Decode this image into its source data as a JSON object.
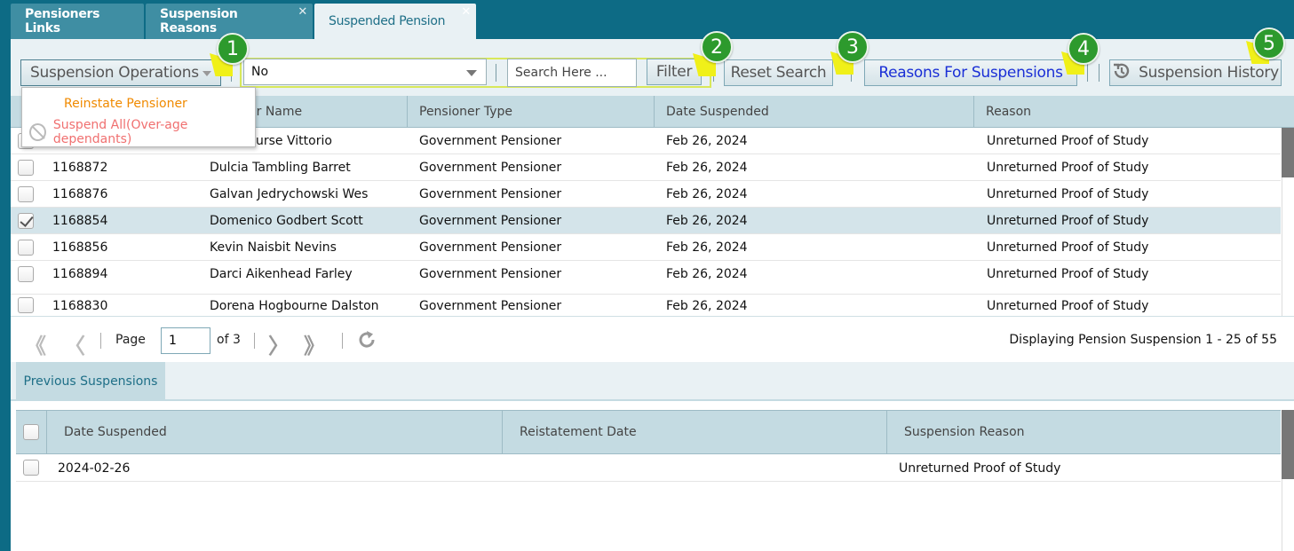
{
  "tabs": [
    {
      "label": "Pensioners Links",
      "closable": false,
      "active": false
    },
    {
      "label": "Suspension Reasons",
      "closable": true,
      "active": false
    },
    {
      "label": "Suspended Pension",
      "closable": true,
      "active": true
    }
  ],
  "tab_close_glyph": "✕",
  "toolbar": {
    "operations_label": "Suspension Operations",
    "filter_select_value": "No",
    "search_placeholder": "Search Here ...",
    "filter_label": "Filter",
    "reset_label": "Reset Search",
    "reasons_label": "Reasons For Suspensions",
    "history_label": "Suspension History"
  },
  "callouts": [
    "1",
    "2",
    "3",
    "4",
    "5"
  ],
  "operations_menu": [
    {
      "label": "Reinstate Pensioner",
      "icon": ""
    },
    {
      "label": "Suspend All(Over-age dependants)",
      "icon": "ban-icon"
    }
  ],
  "grid": {
    "columns": [
      "",
      "",
      "er Name",
      "Pensioner Type",
      "Date Suspended",
      "Reason"
    ],
    "rows": [
      {
        "id": "",
        "name": "urse Vittorio",
        "type": "Government Pensioner",
        "date": "Feb 26, 2024",
        "reason": "Unreturned Proof of Study",
        "checked": false
      },
      {
        "id": "1168872",
        "name": "Dulcia Tambling Barret",
        "type": "Government Pensioner",
        "date": "Feb 26, 2024",
        "reason": "Unreturned Proof of Study",
        "checked": false
      },
      {
        "id": "1168876",
        "name": "Galvan Jedrychowski Wes",
        "type": "Government Pensioner",
        "date": "Feb 26, 2024",
        "reason": "Unreturned Proof of Study",
        "checked": false
      },
      {
        "id": "1168854",
        "name": "Domenico Godbert Scott",
        "type": "Government Pensioner",
        "date": "Feb 26, 2024",
        "reason": "Unreturned Proof of Study",
        "checked": true
      },
      {
        "id": "1168856",
        "name": "Kevin Naisbit Nevins",
        "type": "Government Pensioner",
        "date": "Feb 26, 2024",
        "reason": "Unreturned Proof of Study",
        "checked": false
      },
      {
        "id": "1168894",
        "name": "Darci Aikenhead Farley",
        "type": "Government Pensioner",
        "date": "Feb 26, 2024",
        "reason": "Unreturned Proof of Study",
        "checked": false
      },
      {
        "id": "1168830",
        "name": "Dorena Hogbourne Dalston",
        "type": "Government Pensioner",
        "date": "Feb 26, 2024",
        "reason": "Unreturned Proof of Study",
        "checked": false
      }
    ]
  },
  "pager": {
    "page_label": "Page",
    "current_page": "1",
    "of_label": "of 3",
    "display_info": "Displaying Pension Suspension 1 - 25 of 55"
  },
  "previous": {
    "tab_label": "Previous Suspensions",
    "columns": [
      "Date Suspended",
      "Reistatement Date",
      "Suspension Reason"
    ],
    "rows": [
      {
        "date_suspended": "2024-02-26",
        "reinstatement_date": "",
        "reason": "Unreturned Proof of Study"
      }
    ]
  },
  "colors": {
    "frame": "#0d6b85",
    "header_bg": "#c4dbe2",
    "callout_green": "#2d9a2d",
    "callout_flag": "#f0f019",
    "highlight_border": "#d8e85a",
    "reasons_text": "#1a2fd6",
    "menu_reinstate": "#f08a00",
    "menu_suspend": "#f07070"
  }
}
